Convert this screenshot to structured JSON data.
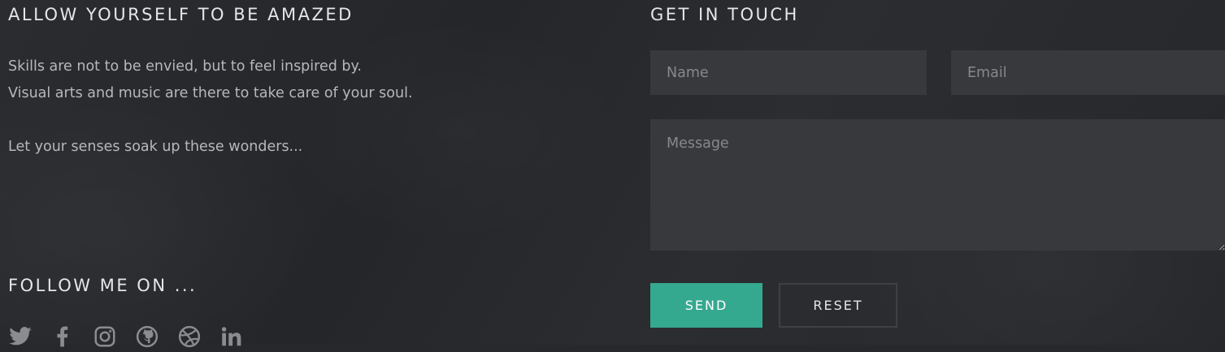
{
  "about": {
    "heading": "ALLOW YOURSELF TO BE AMAZED",
    "lines": [
      "Skills are not to be envied, but to feel inspired by.",
      "Visual arts and music are there to take care of your soul.",
      "Let your senses soak up these wonders..."
    ]
  },
  "social": {
    "heading": "FOLLOW ME ON ...",
    "icon_color": "#8a8c8f",
    "icons": [
      "twitter-icon",
      "facebook-icon",
      "instagram-icon",
      "github-icon",
      "dribbble-icon",
      "linkedin-icon"
    ]
  },
  "contact": {
    "heading": "GET IN TOUCH",
    "name_placeholder": "Name",
    "email_placeholder": "Email",
    "message_placeholder": "Message",
    "send_label": "SEND",
    "reset_label": "RESET",
    "accent_color": "#35a98f"
  }
}
